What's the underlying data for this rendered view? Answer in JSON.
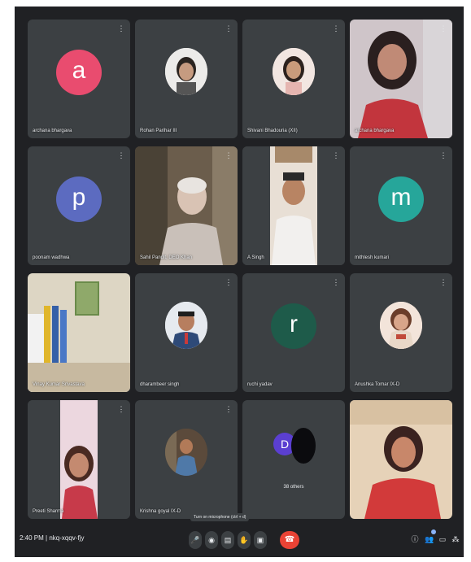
{
  "participants": [
    {
      "name": "archana bhargava",
      "initial": "a",
      "color": "#e94c6f"
    },
    {
      "name": "Rohan Parihar III",
      "type": "photo"
    },
    {
      "name": "Shivani Bhadouria (XII)",
      "type": "photo"
    },
    {
      "name": "archana bhargava",
      "type": "video"
    },
    {
      "name": "poonam wadhwa",
      "initial": "p",
      "color": "#5c6bc0"
    },
    {
      "name": "Sahil Pandit, DEO Khan",
      "type": "video"
    },
    {
      "name": "A Singh",
      "type": "video"
    },
    {
      "name": "mithlesh kumari",
      "initial": "m",
      "color": "#26a69a"
    },
    {
      "name": "Vinay Kumar Srivastava",
      "type": "video"
    },
    {
      "name": "dharambeer singh",
      "type": "photo"
    },
    {
      "name": "ruchi yadav",
      "initial": "r",
      "color": "#1e5b4a"
    },
    {
      "name": "Anushka Tomar IX-D",
      "type": "photo"
    },
    {
      "name": "Preeti Sharma",
      "type": "video"
    },
    {
      "name": "Krishna goyal IX-D",
      "type": "photo"
    },
    {
      "name": "38 others",
      "initial": "D",
      "color": "#5b3fd1",
      "type": "others"
    },
    {
      "name": "",
      "type": "video"
    }
  ],
  "mic_icon": "mic-off-icon",
  "toolbar": {
    "time": "2:40 PM",
    "meeting_code": "nkq-xqqv-fjy",
    "tooltip": "Turn on microphone (ctrl + d)",
    "controls": [
      "mic-icon",
      "camera-icon",
      "captions-icon",
      "raise-hand-icon",
      "present-icon",
      "more-icon"
    ],
    "end_call": "end-call-icon",
    "right_icons": [
      "info-icon",
      "people-icon",
      "chat-icon",
      "activities-icon"
    ],
    "people_count": "48"
  },
  "colors": {
    "background": "#202124",
    "tile": "#3c4043",
    "end_call": "#ea4335"
  }
}
